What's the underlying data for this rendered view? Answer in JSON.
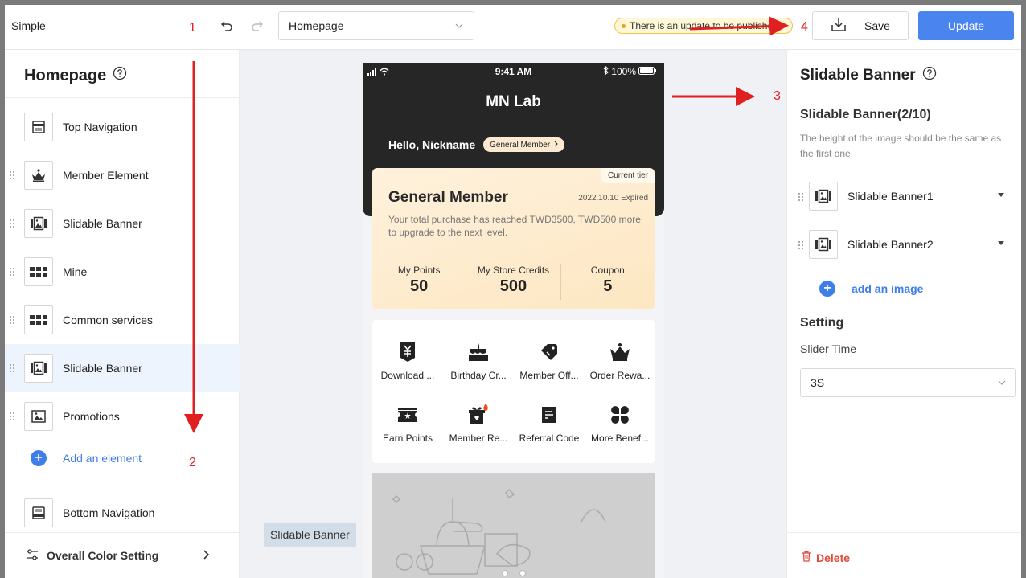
{
  "topbar": {
    "app_name": "Simple",
    "page_select": "Homepage",
    "update_notice": "There is an update to be published",
    "save_label": "Save",
    "update_label": "Update"
  },
  "sidebar": {
    "title": "Homepage",
    "items": [
      {
        "label": "Top Navigation",
        "icon": "top-navigation-icon"
      },
      {
        "label": "Member Element",
        "icon": "crown-icon"
      },
      {
        "label": "Slidable Banner",
        "icon": "image-gallery-icon"
      },
      {
        "label": "Mine",
        "icon": "grid-icon"
      },
      {
        "label": "Common services",
        "icon": "grid-icon"
      },
      {
        "label": "Slidable Banner",
        "icon": "image-gallery-icon"
      },
      {
        "label": "Promotions",
        "icon": "image-icon"
      }
    ],
    "add_element": "Add an element",
    "bottom_nav": "Bottom Navigation",
    "color_setting": "Overall Color Setting"
  },
  "phone": {
    "status_time": "9:41 AM",
    "battery": "100%",
    "brand": "MN Lab",
    "hello": "Hello, Nickname",
    "member_pill": "General Member",
    "tier": "Current tier",
    "card_title": "General Member",
    "expired": "2022.10.10 Expired",
    "desc": "Your total purchase has reached TWD3500, TWD500 more to upgrade to the next level.",
    "stats": [
      {
        "label": "My Points",
        "value": "50"
      },
      {
        "label": "My Store Credits",
        "value": "500"
      },
      {
        "label": "Coupon",
        "value": "5"
      }
    ],
    "services": [
      {
        "label": "Download ...",
        "icon": "yen-shield-icon"
      },
      {
        "label": "Birthday Cr...",
        "icon": "cake-icon"
      },
      {
        "label": "Member Off...",
        "icon": "tag-icon"
      },
      {
        "label": "Order Rewa...",
        "icon": "crown-icon"
      },
      {
        "label": "Earn Points",
        "icon": "ticket-icon"
      },
      {
        "label": "Member Re...",
        "icon": "gift-box-icon"
      },
      {
        "label": "Referral Code",
        "icon": "document-icon"
      },
      {
        "label": "More Benef...",
        "icon": "four-leaf-icon"
      }
    ]
  },
  "canvas_tag": "Slidable Banner",
  "rpanel": {
    "title": "Slidable Banner",
    "subtitle": "Slidable Banner(2/10)",
    "hint": "The height of the image should be the same as the first one.",
    "banners": [
      "Slidable Banner1",
      "Slidable Banner2"
    ],
    "add_image": "add an image",
    "setting": "Setting",
    "slider_label": "Slider Time",
    "slider_value": "3S",
    "delete": "Delete"
  },
  "annotations": [
    "1",
    "2",
    "3",
    "4"
  ],
  "colors": {
    "accent": "#4a84ee",
    "annotation": "#e02020",
    "danger": "#e04b3a"
  }
}
